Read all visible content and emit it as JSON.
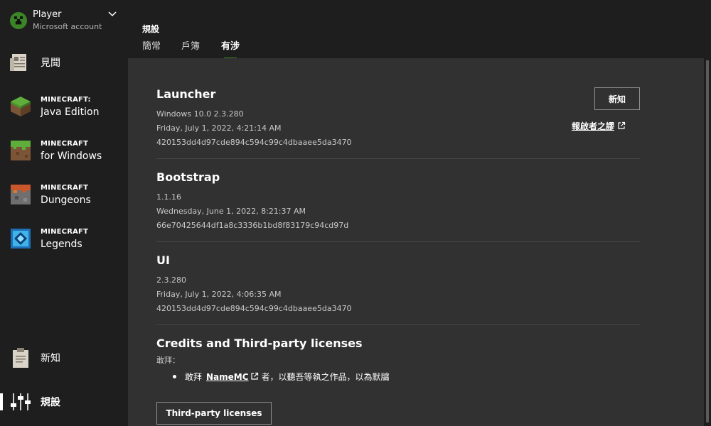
{
  "account": {
    "name": "Player",
    "type": "Microsoft account"
  },
  "sidebar": {
    "items": [
      {
        "label": "見聞"
      },
      {
        "top": "MINECRAFT:",
        "bottom": "Java Edition"
      },
      {
        "top": "MINECRAFT",
        "bottom": "for Windows"
      },
      {
        "top": "MINECRAFT",
        "bottom": "Dungeons"
      },
      {
        "top": "MINECRAFT",
        "bottom": "Legends"
      },
      {
        "label": "新知"
      },
      {
        "label": "規設"
      }
    ]
  },
  "header": {
    "section_title": "規設",
    "tabs": [
      "簡常",
      "戶簿",
      "有涉"
    ],
    "active_tab_index": 2
  },
  "about": {
    "new_button": "新知",
    "report_link": "報啟者之謬",
    "sections": [
      {
        "title": "Launcher",
        "lines": [
          "Windows 10.0 2.3.280",
          "Friday, July 1, 2022, 4:21:14 AM",
          "420153dd4d97cde894c594c99c4dbaaee5da3470"
        ]
      },
      {
        "title": "Bootstrap",
        "lines": [
          "1.1.16",
          "Wednesday, June 1, 2022, 8:21:37 AM",
          "66e70425644df1a8c3336b1bd8f83179c94cd97d"
        ]
      },
      {
        "title": "UI",
        "lines": [
          "2.3.280",
          "Friday, July 1, 2022, 4:06:35 AM",
          "420153dd4d97cde894c594c99c4dbaaee5da3470"
        ]
      }
    ],
    "credits": {
      "title": "Credits and Third-party licenses",
      "subtitle": "敢拜：",
      "item_prefix": "敢拜",
      "item_link": "NameMC",
      "item_suffix": "者，以聽吾等執之作品，以為默牖",
      "licenses_button": "Third-party licenses"
    }
  },
  "colors": {
    "sidebar_bg": "#1e1e1e",
    "content_bg": "#313131",
    "accent_green": "#3c8527"
  }
}
